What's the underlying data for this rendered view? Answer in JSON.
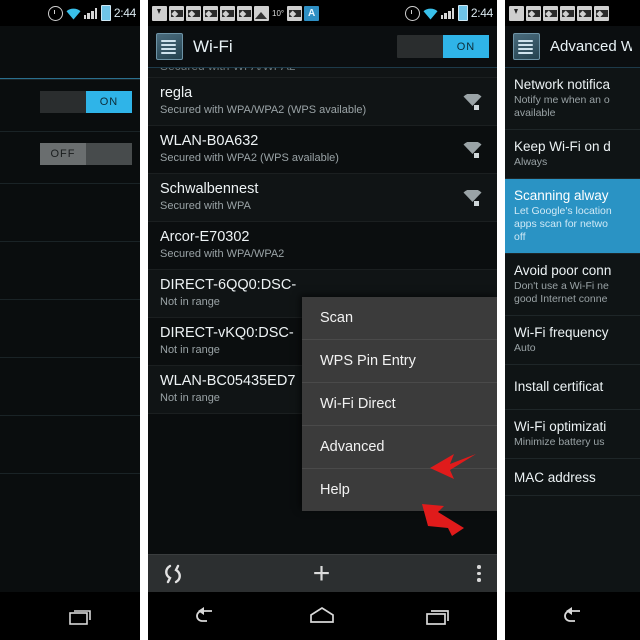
{
  "left_panel": {
    "name": "settings-wireless-cropped",
    "statusbar": {
      "icons": [
        "alarm-icon",
        "wifi-icon",
        "signal-icon",
        "battery-icon"
      ],
      "time": "2:44"
    },
    "rows": [
      {
        "toggle": "ON"
      },
      {
        "toggle": "OFF"
      },
      {
        "toggle": ""
      },
      {
        "toggle": ""
      },
      {
        "toggle": ""
      },
      {
        "toggle": ""
      }
    ],
    "navbar": {
      "recents": "recents-icon"
    }
  },
  "mid_panel": {
    "name": "wifi-settings-with-overflow-menu",
    "statusbar": {
      "notif_icons": [
        "download-icon",
        "envelope-icon",
        "envelope-icon",
        "envelope-icon",
        "envelope-icon",
        "envelope-icon",
        "image-icon"
      ],
      "temperature": "10°",
      "notif_icons_2": [
        "envelope-icon",
        "app-a-icon"
      ],
      "sys_icons": [
        "alarm-icon",
        "wifi-icon",
        "signal-icon",
        "battery-icon"
      ],
      "time": "2:44"
    },
    "actionbar": {
      "app_icon": "wifi-settings-icon",
      "title": "Wi-Fi",
      "toggle_label": "ON"
    },
    "networks": [
      {
        "ssid": "regla",
        "status": "Secured with WPA/WPA2 (WPS available)",
        "signal": "wifi-secured-icon"
      },
      {
        "ssid": "WLAN-B0A632",
        "status": "Secured with WPA2 (WPS available)",
        "signal": "wifi-secured-icon"
      },
      {
        "ssid": "Schwalbennest",
        "status": "Secured with WPA",
        "signal": "wifi-secured-icon"
      },
      {
        "ssid": "Arcor-E70302",
        "status": "Secured with WPA/WPA2",
        "signal": ""
      },
      {
        "ssid": "DIRECT-6QQ0:DSC-",
        "status": "Not in range",
        "signal": ""
      },
      {
        "ssid": "DIRECT-vKQ0:DSC-",
        "status": "Not in range",
        "signal": ""
      },
      {
        "ssid": "WLAN-BC05435ED7",
        "status": "Not in range",
        "signal": ""
      }
    ],
    "overflow_menu": [
      {
        "label": "Scan"
      },
      {
        "label": "WPS Pin Entry"
      },
      {
        "label": "Wi-Fi Direct"
      },
      {
        "label": "Advanced"
      },
      {
        "label": "Help"
      }
    ],
    "toolbar": {
      "wps_icon": "wps-icon",
      "add_label": "+",
      "overflow_icon": "overflow-menu-icon"
    },
    "navbar": {
      "back": "back-icon",
      "home": "home-icon",
      "recents": "recents-icon"
    }
  },
  "right_panel": {
    "name": "advanced-wifi-settings-cropped",
    "statusbar": {
      "notif_icons": [
        "download-icon",
        "envelope-icon",
        "envelope-icon",
        "envelope-icon",
        "envelope-icon",
        "envelope-icon"
      ]
    },
    "actionbar": {
      "app_icon": "wifi-settings-icon",
      "title": "Advanced W"
    },
    "rows": [
      {
        "title": "Network notifica",
        "sub": "Notify me when an o\navailable",
        "selected": false
      },
      {
        "title": "Keep Wi-Fi on d",
        "sub": "Always",
        "selected": false
      },
      {
        "title": "Scanning alway",
        "sub": "Let Google's location\napps scan for netwo\noff",
        "selected": true
      },
      {
        "title": "Avoid poor conn",
        "sub": "Don't use a Wi-Fi ne\ngood Internet conne",
        "selected": false
      },
      {
        "title": "Wi-Fi frequency",
        "sub": "Auto",
        "selected": false
      },
      {
        "title": "Install certificat",
        "sub": "",
        "selected": false
      },
      {
        "title": "Wi-Fi optimizati",
        "sub": "Minimize battery us",
        "selected": false
      },
      {
        "title": "MAC address",
        "sub": "",
        "selected": false
      }
    ],
    "navbar": {
      "back": "back-icon"
    }
  },
  "annotations": {
    "arrow_advanced": "red-arrow-pointing-to-advanced",
    "arrow_overflow": "red-arrow-pointing-to-overflow-menu"
  },
  "colors": {
    "accent_blue": "#2fb4e8",
    "selected_blue": "#2a93c4",
    "arrow_red": "#e01b1b",
    "menu_bg": "#3b3b3b",
    "panel_bg": "#0a0d0e"
  }
}
